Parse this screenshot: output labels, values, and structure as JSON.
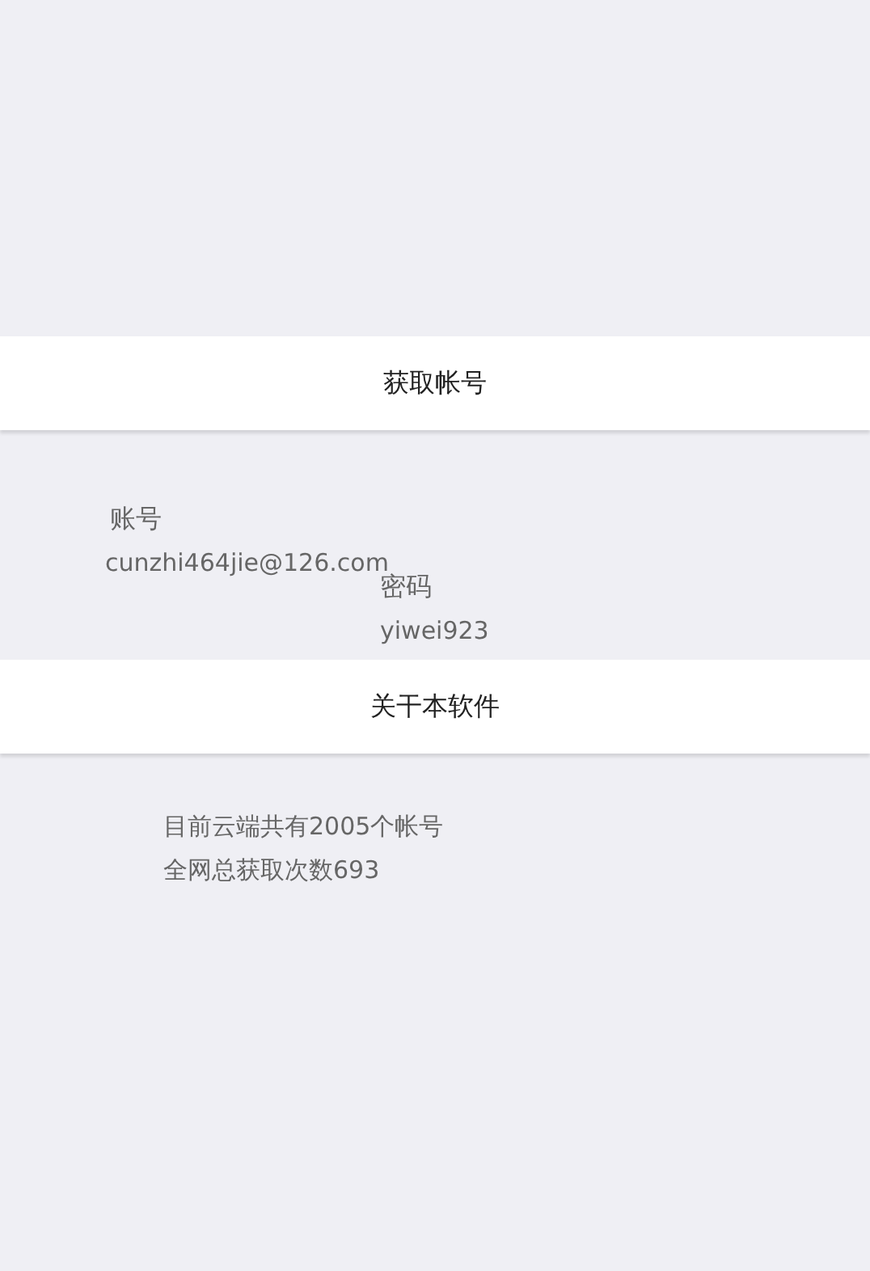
{
  "get_account_button": {
    "label": "获取帐号"
  },
  "account": {
    "label": "账号",
    "value": "cunzhi464jie@126.com"
  },
  "password": {
    "label": "密码",
    "value": "yiwei923"
  },
  "about_button": {
    "label": "关干本软件"
  },
  "stats": [
    "目前云端共有2005个帐号",
    "全网总获取次数693"
  ]
}
